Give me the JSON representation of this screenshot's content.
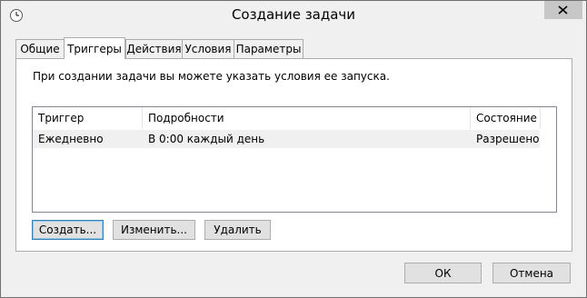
{
  "window": {
    "title": "Создание задачи",
    "icon": "clock-icon"
  },
  "tabs": [
    {
      "label": "Общие",
      "active": false
    },
    {
      "label": "Триггеры",
      "active": true
    },
    {
      "label": "Действия",
      "active": false
    },
    {
      "label": "Условия",
      "active": false
    },
    {
      "label": "Параметры",
      "active": false
    }
  ],
  "triggers": {
    "intro": "При создании задачи вы можете указать условия ее запуска.",
    "columns": [
      "Триггер",
      "Подробности",
      "Состояние"
    ],
    "rows": [
      {
        "trigger": "Ежедневно",
        "details": "В 0:00 каждый день",
        "status": "Разрешено"
      }
    ],
    "buttons": {
      "create": "Создать...",
      "edit": "Изменить...",
      "delete": "Удалить"
    }
  },
  "dialog_buttons": {
    "ok": "ОК",
    "cancel": "Отмена"
  },
  "colors": {
    "window_bg": "#f0f0f0",
    "close_bg": "#c7c7c7",
    "selected_row": "#f0f0f0"
  }
}
